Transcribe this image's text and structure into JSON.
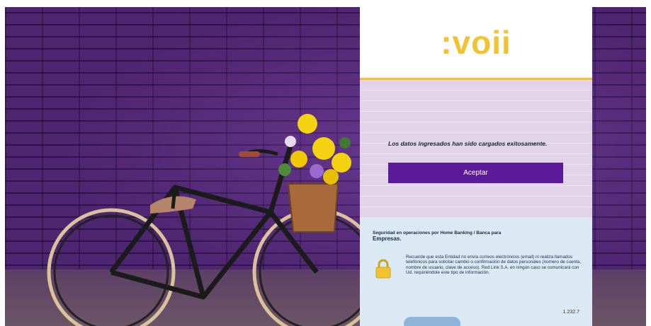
{
  "brand": {
    "logo_text": ":voii",
    "accent_color": "#f2c230",
    "button_color": "#5a1a9a"
  },
  "message": {
    "text": "Los datos ingresados han sido cargados exitosamente.",
    "accept_label": "Aceptar"
  },
  "security": {
    "title_small": "Seguridad en operaciones por Home Banking / Banca para",
    "title_big": "Empresas.",
    "body": "Recuerde que esta Entidad no envía correos electrónicos (email) ni realiza llamados telefónicos para solicitar cambio o confirmación de datos personales (número de cuenta, nombre de usuario, clave de acceso). Red Link S.A. en ningún caso se comunicará con Ud. requiriéndole este tipo de información.",
    "lock_icon": "padlock-icon",
    "version": "1.232.7"
  }
}
